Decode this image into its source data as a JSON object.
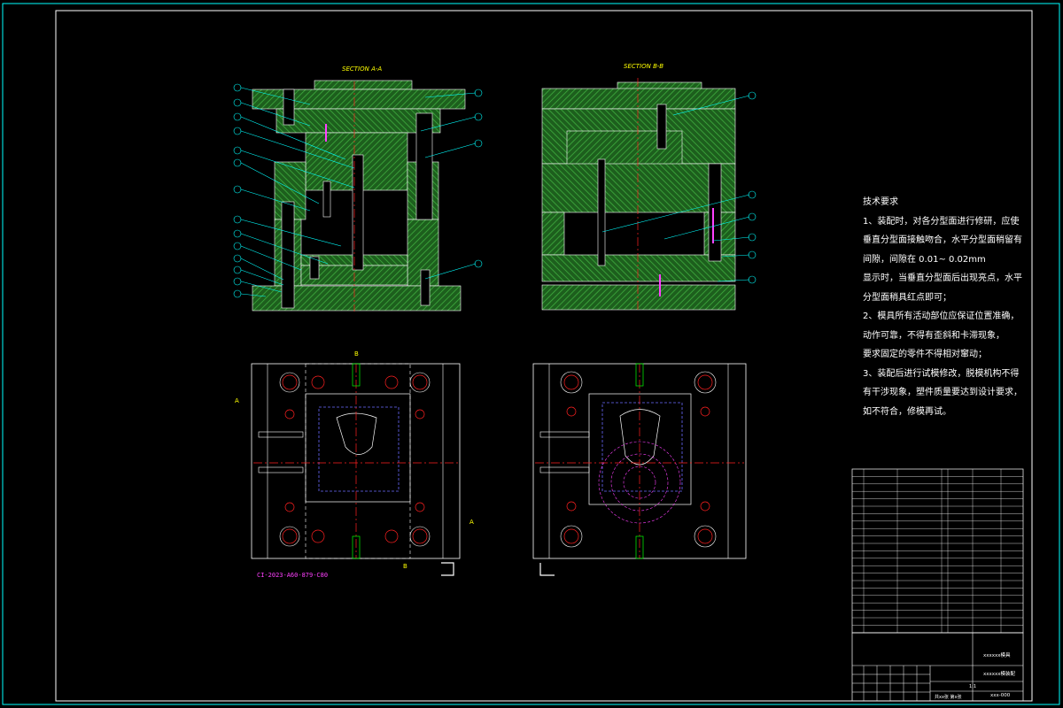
{
  "sections": {
    "a": "SECTION A-A",
    "b": "SECTION B-B"
  },
  "drawing_code": "CI-2023-A60-879-C80",
  "tech_requirements": {
    "title": "技术要求",
    "lines": [
      "1、装配时，对各分型面进行修研，应使",
      "垂直分型面接触吻合，水平分型面稍留有",
      "间隙，间隙在  0.01~  0.02mm",
      "显示时，当垂直分型面后出现亮点，水平",
      "分型面稍具红点即可；",
      "2、模具所有活动部位应保证位置准确，",
      "动作可靠，不得有歪斜和卡滞现象，",
      "要求固定的零件不得相对窜动；",
      "3、装配后进行试模修改，脱模机构不得",
      "有干涉现象，塑件质量要达到设计要求，",
      "如不符合，修模再试。"
    ]
  },
  "section_marks": {
    "A": "A",
    "B": "B"
  },
  "title_block": {
    "name": "xxxxxx模具",
    "sub": "xxxxxx模装配",
    "drawing_no": "xxx-000",
    "scale": "共xx张 第x张",
    "scale_value": "1:1"
  },
  "colors": {
    "background": "#000000",
    "hatch": "#2f8a2f",
    "line_white": "#ffffff",
    "line_cyan": "#00ffff",
    "line_red": "#ff2020",
    "line_yellow": "#ffff00",
    "line_magenta": "#ff40ff",
    "line_blue": "#6a6aff"
  }
}
